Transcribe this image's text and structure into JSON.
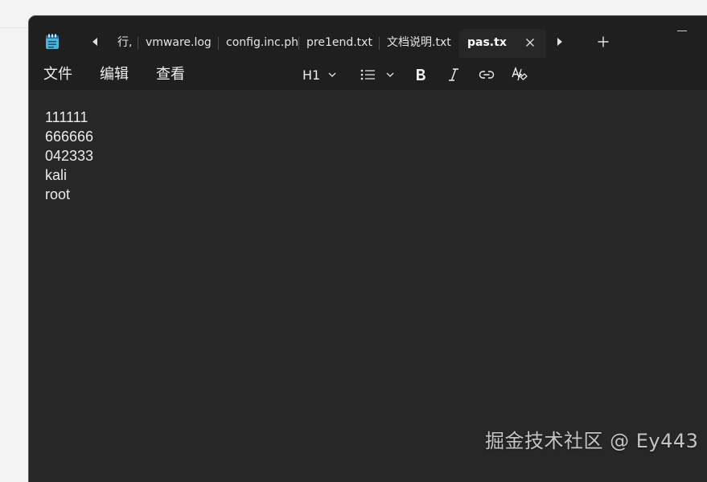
{
  "tabs": [
    {
      "label": "行,"
    },
    {
      "label": "vmware.log"
    },
    {
      "label": "config.inc.ph"
    },
    {
      "label": "pre1end.txt"
    },
    {
      "label": "文档说明.txt"
    },
    {
      "label": "pas.tx",
      "active": true
    }
  ],
  "menu": {
    "file": "文件",
    "edit": "编辑",
    "view": "查看"
  },
  "toolbar": {
    "heading": "H1"
  },
  "editor": {
    "lines": [
      "111111",
      "666666",
      "042333",
      "kali",
      "root"
    ]
  },
  "watermark": "掘金技术社区 @ Ey443",
  "colors": {
    "window_bg": "#272727",
    "tabbar_bg": "#1f1f1f",
    "text": "#ececec"
  }
}
